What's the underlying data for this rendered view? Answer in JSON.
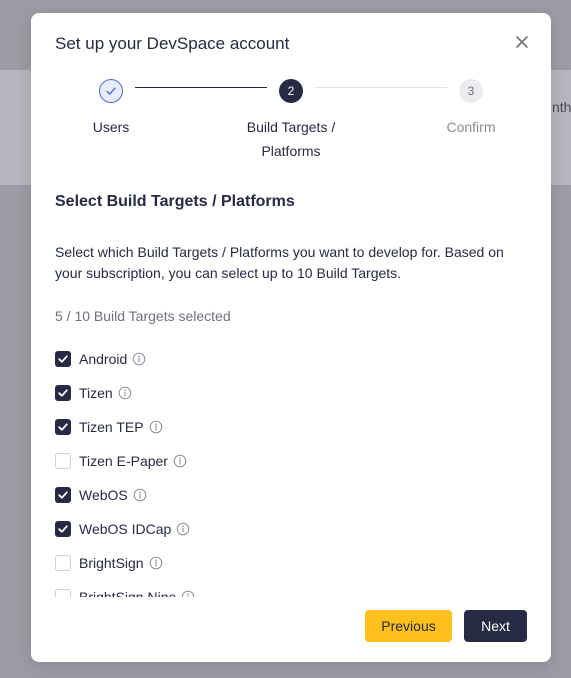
{
  "background": {
    "peek_text": "nth"
  },
  "modal": {
    "title": "Set up your DevSpace account",
    "close_icon": "close-icon"
  },
  "stepper": {
    "steps": [
      {
        "label": "Users",
        "state": "done",
        "icon": "check-icon"
      },
      {
        "number": "2",
        "label_line1": "Build Targets /",
        "label_line2": "Platforms",
        "state": "active"
      },
      {
        "number": "3",
        "label": "Confirm",
        "state": "todo"
      }
    ]
  },
  "section": {
    "title": "Select Build Targets / Platforms",
    "description": "Select which Build Targets / Platforms you want to develop for. Based on your subscription, you can select up to 10 Build Targets.",
    "selected_count": "5 / 10 Build Targets selected"
  },
  "targets": [
    {
      "label": "Android",
      "checked": true
    },
    {
      "label": "Tizen",
      "checked": true
    },
    {
      "label": "Tizen TEP",
      "checked": true
    },
    {
      "label": "Tizen E-Paper",
      "checked": false
    },
    {
      "label": "WebOS",
      "checked": true
    },
    {
      "label": "WebOS IDCap",
      "checked": true
    },
    {
      "label": "BrightSign",
      "checked": false
    },
    {
      "label": "BrightSign Nine",
      "checked": false
    }
  ],
  "footer": {
    "previous_label": "Previous",
    "next_label": "Next"
  },
  "colors": {
    "primary": "#262a44",
    "accent": "#fec11b",
    "step_done_border": "#4a6cd4",
    "muted_text": "#6e7080"
  }
}
